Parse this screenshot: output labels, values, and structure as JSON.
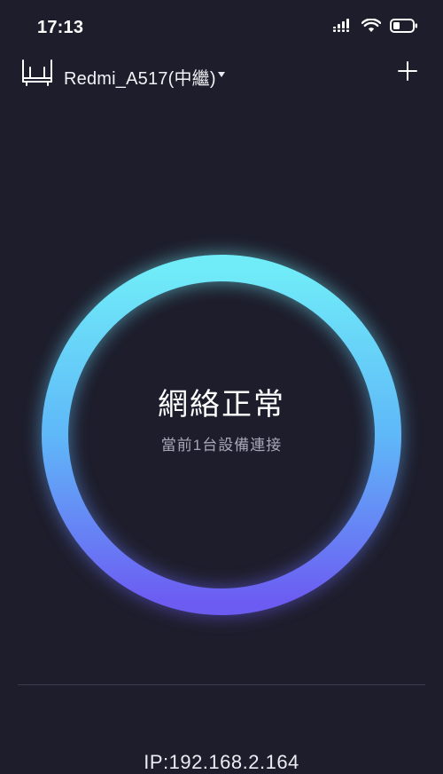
{
  "status_bar": {
    "time": "17:13",
    "icons": [
      "signal-icon",
      "wifi-icon",
      "battery-icon"
    ]
  },
  "header": {
    "router_icon": "router-icon",
    "device_name": "Redmi_A517(中繼)",
    "add_icon": "plus-icon"
  },
  "network_status": {
    "title": "網絡正常",
    "subtitle": "當前1台設備連接"
  },
  "footer": {
    "ip": "IP:192.168.2.164"
  },
  "colors": {
    "background": "#1d1d2b",
    "ring_top": "#6fe9f8",
    "ring_bottom": "#6b5cf2"
  }
}
